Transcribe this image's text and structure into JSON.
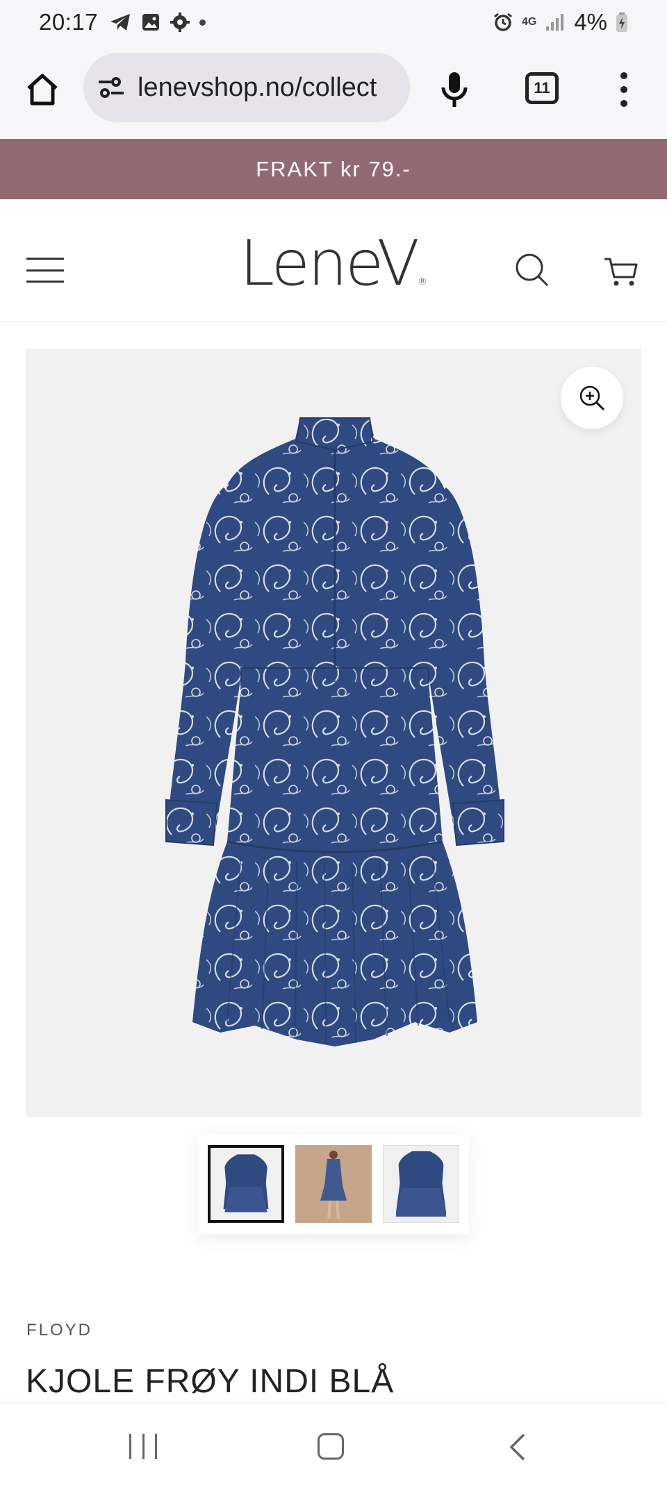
{
  "status_bar": {
    "time": "20:17",
    "network": "4G",
    "battery": "4%"
  },
  "browser": {
    "url": "lenevshop.no/collect",
    "tab_count": "11"
  },
  "promo": {
    "text": "FRAKT kr 79.-"
  },
  "header": {
    "logo_text": "LeneV",
    "logo_mark": "®"
  },
  "product": {
    "brand": "FLOYD",
    "title": "KJOLE FRØY INDI BLÅ",
    "thumbnails": [
      {
        "alt": "product-front",
        "active": true
      },
      {
        "alt": "model-wearing",
        "active": false
      },
      {
        "alt": "product-front-alt",
        "active": false
      }
    ]
  },
  "colors": {
    "promo_bg": "#926a74",
    "dress_blue": "#2f4a80",
    "pattern": "#d8dce6",
    "image_bg": "#f1f1f1"
  },
  "icons": {
    "home": "home-icon",
    "site_info": "tune-icon",
    "mic": "mic-icon",
    "tabs": "tabs-icon",
    "menu": "more-vert-icon",
    "hamburger": "hamburger-icon",
    "search": "search-icon",
    "cart": "cart-icon",
    "zoom": "zoom-in-icon"
  }
}
